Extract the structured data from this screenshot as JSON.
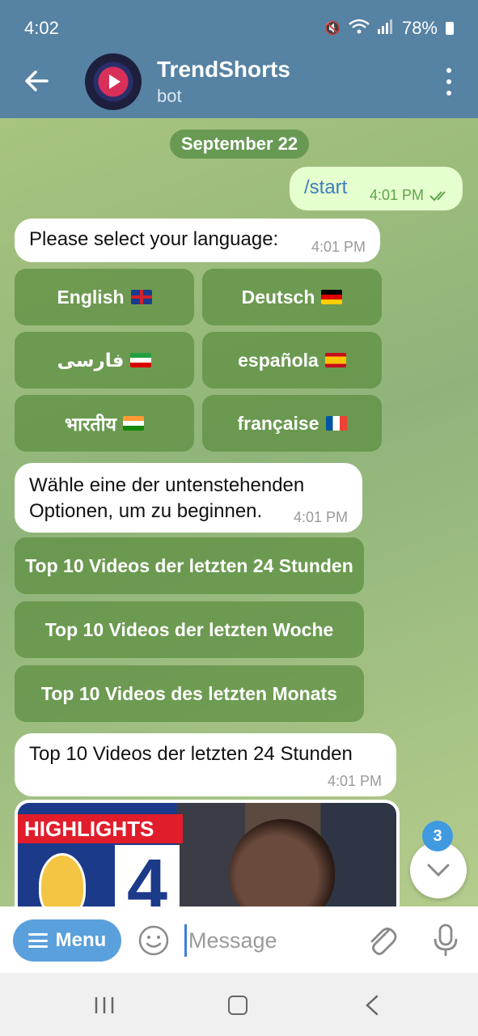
{
  "status_bar": {
    "time": "4:02",
    "battery": "78%"
  },
  "header": {
    "title": "TrendShorts",
    "subtitle": "bot"
  },
  "chat": {
    "date": "September 22",
    "messages": [
      {
        "text": "/start",
        "time": "4:01 PM"
      },
      {
        "text": "Please select your language:",
        "time": "4:01 PM"
      },
      {
        "text_line1": "Wähle eine der untenstehenden",
        "text_line2": "Optionen, um zu beginnen.",
        "time": "4:01 PM"
      },
      {
        "text": "Top 10 Videos der letzten 24 Stunden",
        "time": "4:01 PM"
      }
    ],
    "language_buttons": [
      "English",
      "Deutsch",
      "فارسی",
      "española",
      "भारतीय",
      "française"
    ],
    "option_buttons": [
      "Top 10 Videos der letzten 24 Stunden",
      "Top 10 Videos der letzten Woche",
      "Top 10 Videos des letzten Monats"
    ],
    "media": {
      "banner": "HIGHLIGHTS",
      "score": "4"
    },
    "unread_count": "3"
  },
  "input": {
    "menu_label": "Menu",
    "placeholder": "Message"
  }
}
